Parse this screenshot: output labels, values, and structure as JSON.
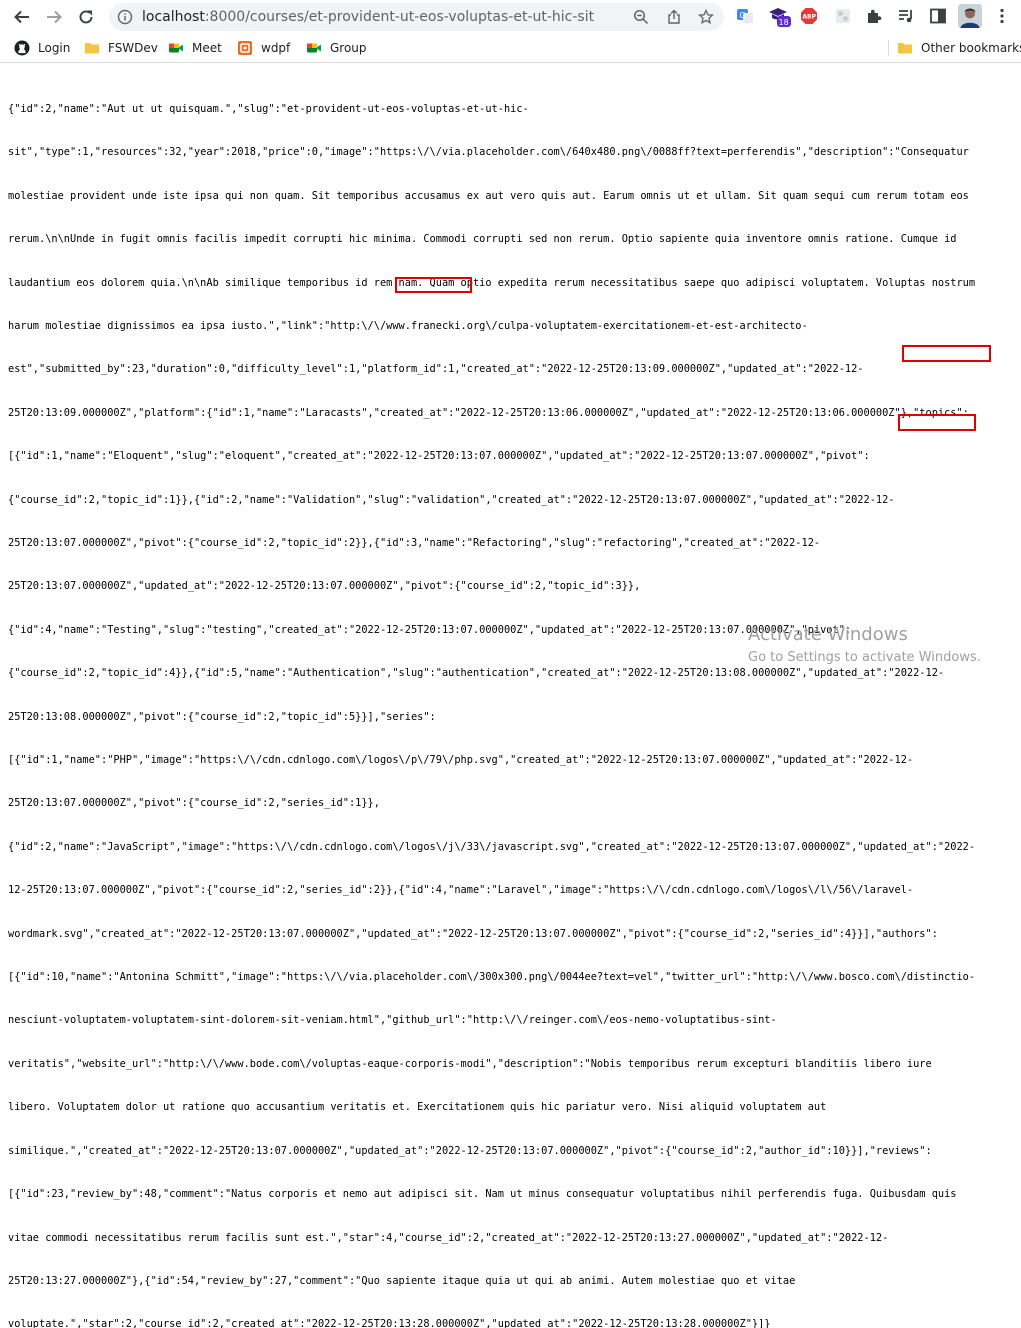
{
  "browser": {
    "url_host": "localhost",
    "url_path": ":8000/courses/et-provident-ut-eos-voluptas-et-ut-hic-sit",
    "extension_badge": "18",
    "adblock_label": "ABP"
  },
  "bookmarks": {
    "items": [
      {
        "label": "Login",
        "icon": "github-icon"
      },
      {
        "label": "FSWDev",
        "icon": "folder-icon"
      },
      {
        "label": "Meet",
        "icon": "meet-icon"
      },
      {
        "label": "wdpf",
        "icon": "wdpf-icon"
      },
      {
        "label": "Group",
        "icon": "meet-icon"
      }
    ],
    "other": "Other bookmarks"
  },
  "json_lines": [
    "{\"id\":2,\"name\":\"Aut ut ut quisquam.\",\"slug\":\"et-provident-ut-eos-voluptas-et-ut-hic-",
    "sit\",\"type\":1,\"resources\":32,\"year\":2018,\"price\":0,\"image\":\"https:\\/\\/via.placeholder.com\\/640x480.png\\/0088ff?text=perferendis\",\"description\":\"Consequatur",
    "molestiae provident unde iste ipsa qui non quam. Sit temporibus accusamus ex aut vero quis aut. Earum omnis ut et ullam. Sit quam sequi cum rerum totam eos",
    "rerum.\\n\\nUnde in fugit omnis facilis impedit corrupti hic minima. Commodi corrupti sed non rerum. Optio sapiente quia inventore omnis ratione. Cumque id",
    "laudantium eos dolorem quia.\\n\\nAb similique temporibus id rem nam. Quam optio expedita rerum necessitatibus saepe quo adipisci voluptatem. Voluptas nostrum",
    "harum molestiae dignissimos ea ipsa iusto.\",\"link\":\"http:\\/\\/www.franecki.org\\/culpa-voluptatem-exercitationem-et-est-architecto-",
    "est\",\"submitted_by\":23,\"duration\":0,\"difficulty_level\":1,\"platform_id\":1,\"created_at\":\"2022-12-25T20:13:09.000000Z\",\"updated_at\":\"2022-12-",
    "25T20:13:09.000000Z\",\"platform\":{\"id\":1,\"name\":\"Laracasts\",\"created_at\":\"2022-12-25T20:13:06.000000Z\",\"updated_at\":\"2022-12-25T20:13:06.000000Z\"},\"topics\":",
    "[{\"id\":1,\"name\":\"Eloquent\",\"slug\":\"eloquent\",\"created_at\":\"2022-12-25T20:13:07.000000Z\",\"updated_at\":\"2022-12-25T20:13:07.000000Z\",\"pivot\":",
    "{\"course_id\":2,\"topic_id\":1}},{\"id\":2,\"name\":\"Validation\",\"slug\":\"validation\",\"created_at\":\"2022-12-25T20:13:07.000000Z\",\"updated_at\":\"2022-12-",
    "25T20:13:07.000000Z\",\"pivot\":{\"course_id\":2,\"topic_id\":2}},{\"id\":3,\"name\":\"Refactoring\",\"slug\":\"refactoring\",\"created_at\":\"2022-12-",
    "25T20:13:07.000000Z\",\"updated_at\":\"2022-12-25T20:13:07.000000Z\",\"pivot\":{\"course_id\":2,\"topic_id\":3}},",
    "{\"id\":4,\"name\":\"Testing\",\"slug\":\"testing\",\"created_at\":\"2022-12-25T20:13:07.000000Z\",\"updated_at\":\"2022-12-25T20:13:07.000000Z\",\"pivot\":",
    "{\"course_id\":2,\"topic_id\":4}},{\"id\":5,\"name\":\"Authentication\",\"slug\":\"authentication\",\"created_at\":\"2022-12-25T20:13:08.000000Z\",\"updated_at\":\"2022-12-",
    "25T20:13:08.000000Z\",\"pivot\":{\"course_id\":2,\"topic_id\":5}}],\"series\":",
    "[{\"id\":1,\"name\":\"PHP\",\"image\":\"https:\\/\\/cdn.cdnlogo.com\\/logos\\/p\\/79\\/php.svg\",\"created_at\":\"2022-12-25T20:13:07.000000Z\",\"updated_at\":\"2022-12-",
    "25T20:13:07.000000Z\",\"pivot\":{\"course_id\":2,\"series_id\":1}},",
    "{\"id\":2,\"name\":\"JavaScript\",\"image\":\"https:\\/\\/cdn.cdnlogo.com\\/logos\\/j\\/33\\/javascript.svg\",\"created_at\":\"2022-12-25T20:13:07.000000Z\",\"updated_at\":\"2022-",
    "12-25T20:13:07.000000Z\",\"pivot\":{\"course_id\":2,\"series_id\":2}},{\"id\":4,\"name\":\"Laravel\",\"image\":\"https:\\/\\/cdn.cdnlogo.com\\/logos\\/l\\/56\\/laravel-",
    "wordmark.svg\",\"created_at\":\"2022-12-25T20:13:07.000000Z\",\"updated_at\":\"2022-12-25T20:13:07.000000Z\",\"pivot\":{\"course_id\":2,\"series_id\":4}}],\"authors\":",
    "[{\"id\":10,\"name\":\"Antonina Schmitt\",\"image\":\"https:\\/\\/via.placeholder.com\\/300x300.png\\/0044ee?text=vel\",\"twitter_url\":\"http:\\/\\/www.bosco.com\\/distinctio-",
    "nesciunt-voluptatem-voluptatem-sint-dolorem-sit-veniam.html\",\"github_url\":\"http:\\/\\/reinger.com\\/eos-nemo-voluptatibus-sint-",
    "veritatis\",\"website_url\":\"http:\\/\\/www.bode.com\\/voluptas-eaque-corporis-modi\",\"description\":\"Nobis temporibus rerum excepturi blanditiis libero iure",
    "libero. Voluptatem dolor ut ratione quo accusantium veritatis et. Exercitationem quis hic pariatur vero. Nisi aliquid voluptatem aut",
    "similique.\",\"created_at\":\"2022-12-25T20:13:07.000000Z\",\"updated_at\":\"2022-12-25T20:13:07.000000Z\",\"pivot\":{\"course_id\":2,\"author_id\":10}}],\"reviews\":",
    "[{\"id\":23,\"review_by\":48,\"comment\":\"Natus corporis et nemo aut adipisci sit. Nam ut minus consequatur voluptatibus nihil perferendis fuga. Quibusdam quis",
    "vitae commodi necessitatibus rerum facilis sunt est.\",\"star\":4,\"course_id\":2,\"created_at\":\"2022-12-25T20:13:27.000000Z\",\"updated_at\":\"2022-12-",
    "25T20:13:27.000000Z\"},{\"id\":54,\"review_by\":27,\"comment\":\"Quo sapiente itaque quia ut qui ab animi. Autem molestiae quo et vitae",
    "voluptate.\",\"star\":2,\"course_id\":2,\"created_at\":\"2022-12-25T20:13:28.000000Z\",\"updated_at\":\"2022-12-25T20:13:28.000000Z\"}]}"
  ],
  "watermark": {
    "title": "Activate Windows",
    "subtitle": "Go to Settings to activate Windows."
  }
}
